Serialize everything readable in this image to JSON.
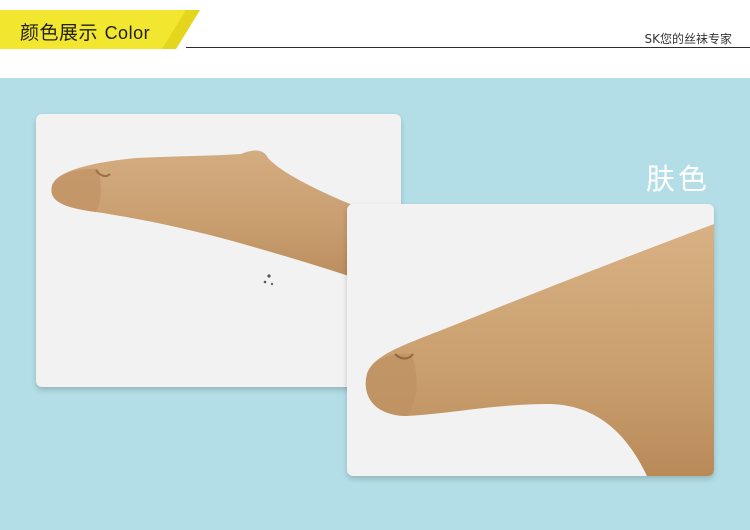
{
  "header": {
    "title_cn": "颜色展示",
    "title_en": "Color",
    "brand": "SK您的丝袜专家",
    "accent_color": "#f2e62f"
  },
  "panel": {
    "background_color": "#b4dee7",
    "color_name": "肤色"
  },
  "photos": [
    {
      "subject": "stocking-toe-side-view"
    },
    {
      "subject": "stocking-toe-closeup"
    }
  ]
}
